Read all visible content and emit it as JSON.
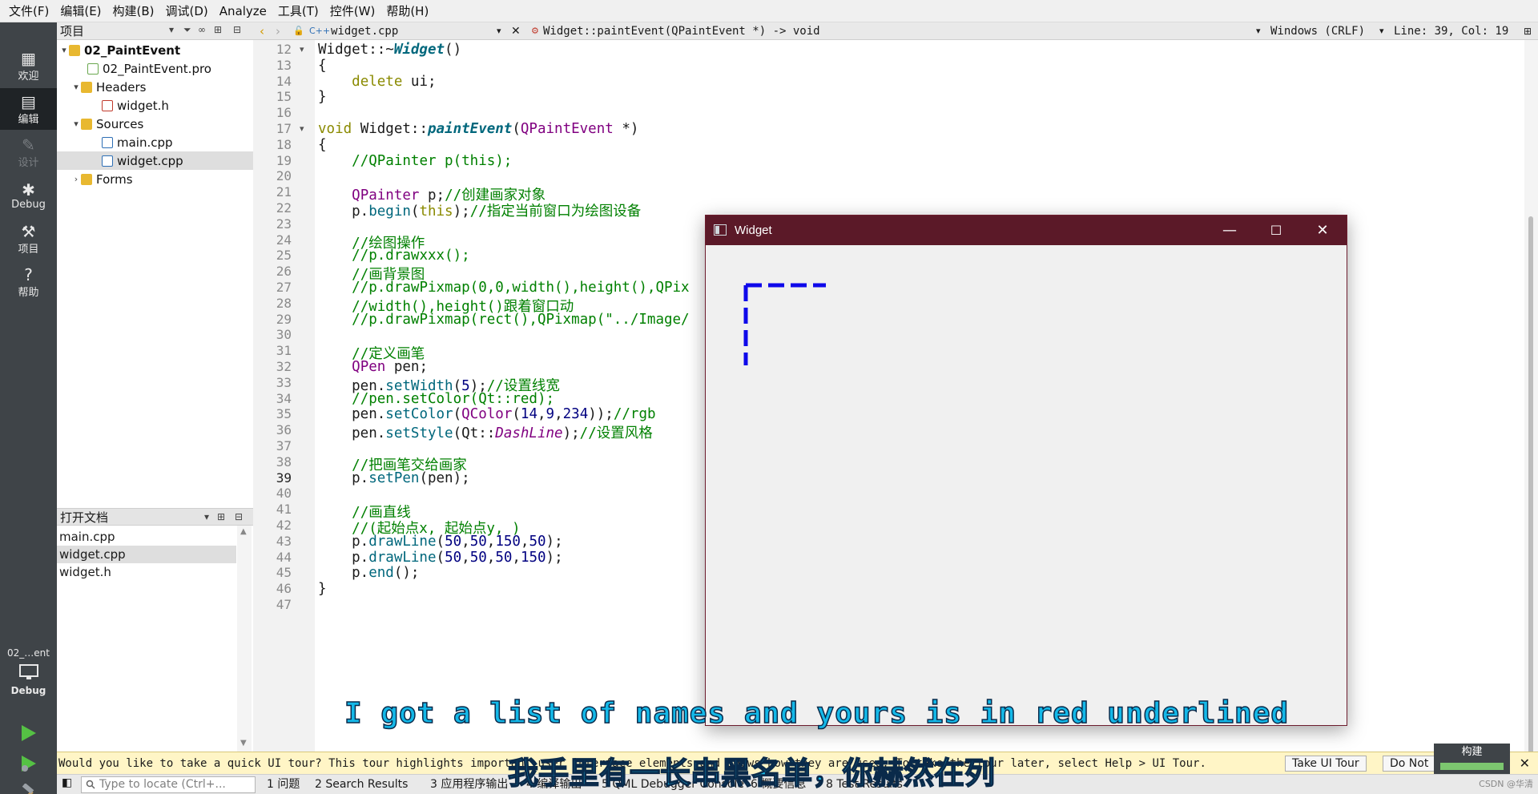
{
  "menu": [
    "文件(F)",
    "编辑(E)",
    "构建(B)",
    "调试(D)",
    "Analyze",
    "工具(T)",
    "控件(W)",
    "帮助(H)"
  ],
  "modes": [
    {
      "label": "欢迎",
      "icon": "grid-icon"
    },
    {
      "label": "编辑",
      "icon": "edit-icon"
    },
    {
      "label": "设计",
      "icon": "design-pen-icon"
    },
    {
      "label": "Debug",
      "icon": "bug-icon"
    },
    {
      "label": "项目",
      "icon": "wrench-icon"
    },
    {
      "label": "帮助",
      "icon": "help-icon"
    }
  ],
  "target": {
    "project_short": "02_…ent",
    "mode": "Debug"
  },
  "project_pane": {
    "title": "项目",
    "tree": [
      {
        "label": "02_PaintEvent",
        "kind": "project",
        "expanded": true
      },
      {
        "label": "02_PaintEvent.pro",
        "kind": "pro"
      },
      {
        "label": "Headers",
        "kind": "folder",
        "expanded": true
      },
      {
        "label": "widget.h",
        "kind": "header"
      },
      {
        "label": "Sources",
        "kind": "folder",
        "expanded": true
      },
      {
        "label": "main.cpp",
        "kind": "cpp"
      },
      {
        "label": "widget.cpp",
        "kind": "cpp",
        "selected": true
      },
      {
        "label": "Forms",
        "kind": "folder",
        "expanded": false
      }
    ]
  },
  "open_docs": {
    "title": "打开文档",
    "items": [
      "main.cpp",
      "widget.cpp",
      "widget.h"
    ],
    "selected": 1
  },
  "editor_toolbar": {
    "file": "widget.cpp",
    "symbol": "Widget::paintEvent(QPaintEvent *) -> void",
    "line_ending": "Windows (CRLF)",
    "position": "Line: 39, Col: 19"
  },
  "editor": {
    "first_line": 12,
    "current_line": 39,
    "fold_lines": [
      12,
      17
    ],
    "lines": [
      "Widget::~Widget()",
      "{",
      "    delete ui;",
      "}",
      "",
      "void Widget::paintEvent(QPaintEvent *)",
      "{",
      "    //QPainter p(this);",
      "",
      "    QPainter p;//创建画家对象",
      "    p.begin(this);//指定当前窗口为绘图设备",
      "",
      "    //绘图操作",
      "    //p.drawxxx();",
      "    //画背景图",
      "    //p.drawPixmap(0,0,width(),height(),QPix",
      "    //width(),height()跟着窗口动",
      "    //p.drawPixmap(rect(),QPixmap(\"../Image/",
      "",
      "    //定义画笔",
      "    QPen pen;",
      "    pen.setWidth(5);//设置线宽",
      "    //pen.setColor(Qt::red);",
      "    pen.setColor(QColor(14,9,234));//rgb",
      "    pen.setStyle(Qt::DashLine);//设置风格",
      "",
      "    //把画笔交给画家",
      "    p.setPen(pen);",
      "",
      "    //画直线",
      "    //(起始点x, 起始点y, )",
      "    p.drawLine(50,50,150,50);",
      "    p.drawLine(50,50,50,150);",
      "    p.end();",
      "}",
      ""
    ]
  },
  "widget_window": {
    "title": "Widget",
    "pen_color": "#0e09ea",
    "lines": [
      [
        50,
        50,
        150,
        50
      ],
      [
        50,
        50,
        50,
        150
      ]
    ]
  },
  "infobar": {
    "message": "Would you like to take a quick UI tour? This tour highlights important user interface elements and shows how they are used. To take the tour later, select Help > UI Tour.",
    "take_tour": "Take UI Tour",
    "do_not_show": "Do Not",
    "build_label": "构建"
  },
  "statusbar": {
    "locator_placeholder": "Type to locate (Ctrl+...",
    "tabs": [
      "1 问题",
      "2 Search Results",
      "3 应用程序输出",
      "4 编译输出",
      "5 QML Debugger Console",
      "6 概要信息",
      "8 Test Results"
    ],
    "watermark": "CSDN @华清"
  },
  "subtitles": {
    "en": "I got a list of names and yours is in red underlined",
    "zh": "我手里有一长串黑名单，你赫然在列"
  }
}
